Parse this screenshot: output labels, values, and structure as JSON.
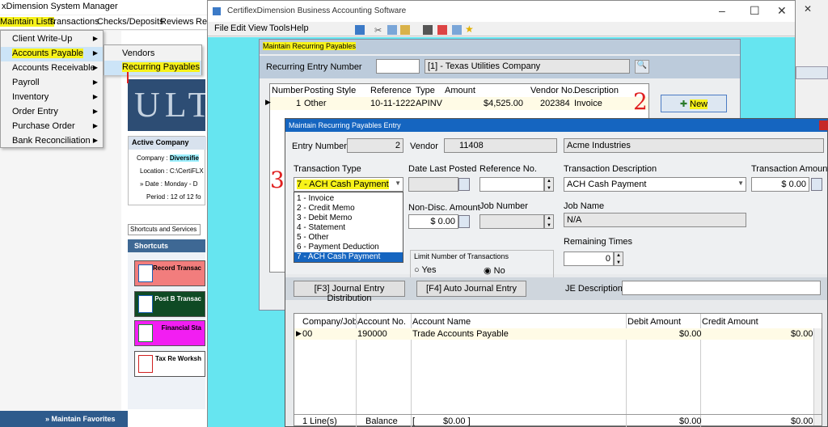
{
  "manager": {
    "title": "xDimension System Manager",
    "menubar": [
      "Maintain Lists",
      "Transactions",
      "Checks/Deposits",
      "Reviews",
      "Re"
    ],
    "menu": [
      "Client Write-Up",
      "Accounts Payable",
      "Accounts Receivable",
      "Payroll",
      "Inventory",
      "Order Entry",
      "Purchase Order",
      "Bank Reconciliation"
    ],
    "submenu": [
      "Vendors",
      "Recurring Payables"
    ],
    "logo_text": "ULT",
    "active_company": {
      "header": "Active Company",
      "company_label": "Company :",
      "company_value": "Diversifie",
      "location": "Location :  C:\\CertiFLX",
      "date": "» Date :  Monday - D",
      "period": "Period :  12 of 12 fo"
    },
    "shortcuts_tab": "Shortcuts and Services",
    "shortcuts_header": "Shortcuts",
    "shortcut_buttons": [
      {
        "label": "Record Transac",
        "color": "#f27d7d"
      },
      {
        "label": "Post B Transac",
        "color": "#0f4a24"
      },
      {
        "label": "Financial Sta",
        "color": "#f21ef2"
      },
      {
        "label": "Tax Re Worksh",
        "color": "#ffffff"
      }
    ],
    "favorites": "» Maintain Favorites"
  },
  "main": {
    "title": "CertiflexDimension Business Accounting Software",
    "menubar": [
      "File",
      "Edit",
      "View",
      "Tools",
      "Help"
    ]
  },
  "recurring": {
    "title": "Maintain Recurring Payables",
    "entry_number_label": "Recurring Entry Number",
    "entry_number_value": "",
    "entry_display": "[1] - Texas Utilities Company",
    "grid_headers": [
      "Number",
      "Posting Style",
      "Reference",
      "Type",
      "Amount",
      "Vendor No.",
      "Description"
    ],
    "grid_row": [
      "1",
      "Other",
      "10-11-1222",
      "APINV",
      "$4,525.00",
      "202384",
      "Invoice"
    ],
    "new_button": "New"
  },
  "annotations": [
    "2",
    "3"
  ],
  "entry": {
    "title": "Maintain Recurring Payables Entry",
    "entry_number_label": "Entry Number",
    "entry_number": "2",
    "vendor_label": "Vendor",
    "vendor_no": "11408",
    "vendor_name": "Acme Industries",
    "transaction_type_label": "Transaction Type",
    "transaction_type_value": "7 - ACH Cash Payment",
    "transaction_types": [
      "1 - Invoice",
      "2 - Credit Memo",
      "3 - Debit Memo",
      "4 - Statement",
      "5 - Other",
      "6 - Payment Deduction",
      "7 - ACH Cash Payment"
    ],
    "date_last_posted_label": "Date Last Posted",
    "date_last_posted": "",
    "reference_label": "Reference No.",
    "reference": "",
    "trans_desc_label": "Transaction Description",
    "trans_desc": "ACH Cash Payment",
    "trans_amount_label": "Transaction Amount",
    "trans_amount": "$ 0.00",
    "non_disc_label": "Non-Disc. Amount",
    "non_disc": "$ 0.00",
    "job_number_label": "Job Number",
    "job_number": "",
    "job_name_label": "Job Name",
    "job_name": "N/A",
    "limit_label": "Limit Number of Transactions",
    "limit_yes": "Yes",
    "limit_no": "No",
    "remaining_label": "Remaining Times",
    "remaining": "0",
    "btn_f3": "[F3] Journal Entry Distribution",
    "btn_f4": "[F4]  Auto Journal Entry",
    "je_desc_label": "JE Description",
    "je_desc": "",
    "grid_headers": [
      "Company/Job",
      "Account No.",
      "Account Name",
      "Debit Amount",
      "Credit Amount"
    ],
    "grid_row": [
      "00",
      "190000",
      "Trade Accounts Payable",
      "$0.00",
      "$0.00"
    ],
    "footer": [
      "1 Line(s)",
      "Balance",
      "[",
      "$0.00 ]",
      "$0.00",
      "$0.00"
    ]
  }
}
